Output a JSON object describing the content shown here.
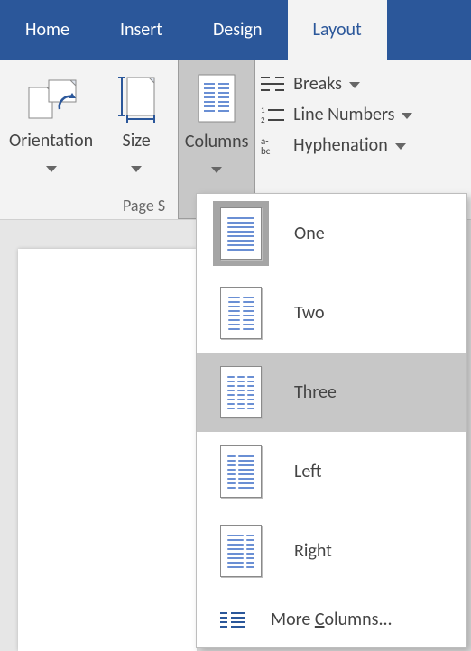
{
  "tabs": {
    "home": "Home",
    "insert": "Insert",
    "design": "Design",
    "layout": "Layout"
  },
  "ribbon": {
    "orientation": "Orientation",
    "size": "Size",
    "columns": "Columns",
    "breaks": "Breaks",
    "line_numbers": "Line Numbers",
    "hyphenation": "Hyphenation",
    "group_label": "Page S"
  },
  "columns_menu": {
    "one": "One",
    "two": "Two",
    "three": "Three",
    "left": "Left",
    "right": "Right",
    "more_prefix": "More ",
    "more_underline": "C",
    "more_suffix": "olumns..."
  },
  "colors": {
    "accent": "#2b579a",
    "line": "#6a8fd4"
  }
}
